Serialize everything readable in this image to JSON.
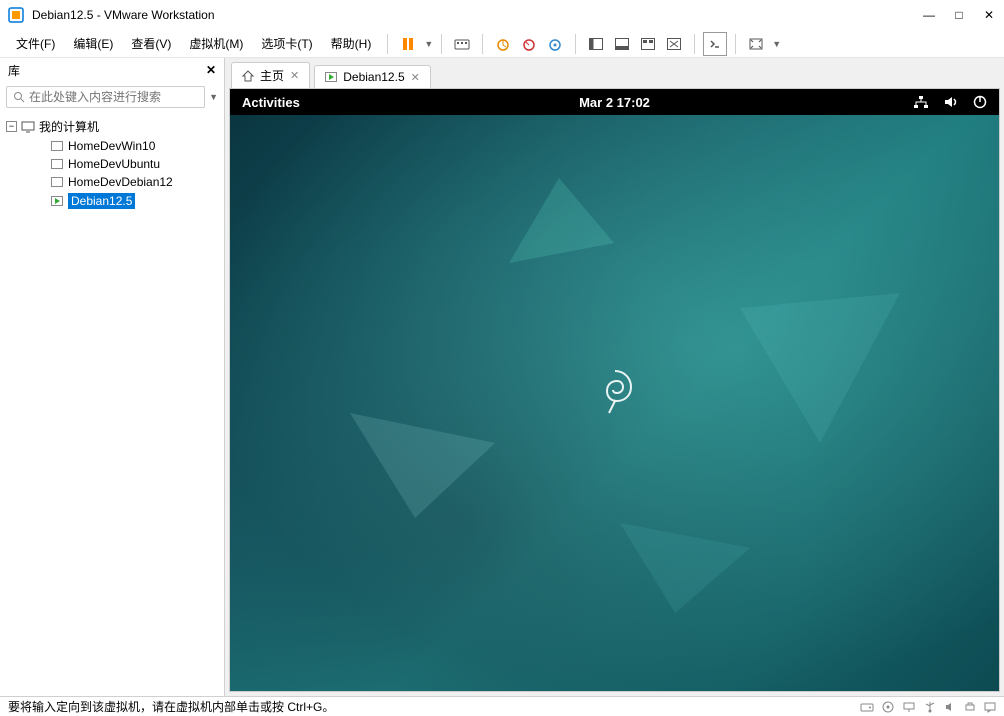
{
  "window": {
    "title": "Debian12.5  - VMware Workstation",
    "controls": {
      "min": "—",
      "max": "□",
      "close": "✕"
    }
  },
  "menu": {
    "items": [
      "文件(F)",
      "编辑(E)",
      "查看(V)",
      "虚拟机(M)",
      "选项卡(T)",
      "帮助(H)"
    ]
  },
  "sidebar": {
    "title": "库",
    "close": "✕",
    "search_placeholder": "在此处键入内容进行搜索",
    "root": "我的计算机",
    "toggle_symbol": "−",
    "items": [
      {
        "name": "HomeDevWin10",
        "selected": false,
        "running": false
      },
      {
        "name": "HomeDevUbuntu",
        "selected": false,
        "running": false
      },
      {
        "name": "HomeDevDebian12",
        "selected": false,
        "running": false
      },
      {
        "name": "Debian12.5",
        "selected": true,
        "running": true
      }
    ]
  },
  "tabs": {
    "home": "主页",
    "vm": "Debian12.5"
  },
  "gnome": {
    "activities": "Activities",
    "datetime": "Mar 2   17:02"
  },
  "statusbar": {
    "hint": "要将输入定向到该虚拟机，请在虚拟机内部单击或按 Ctrl+G。"
  }
}
